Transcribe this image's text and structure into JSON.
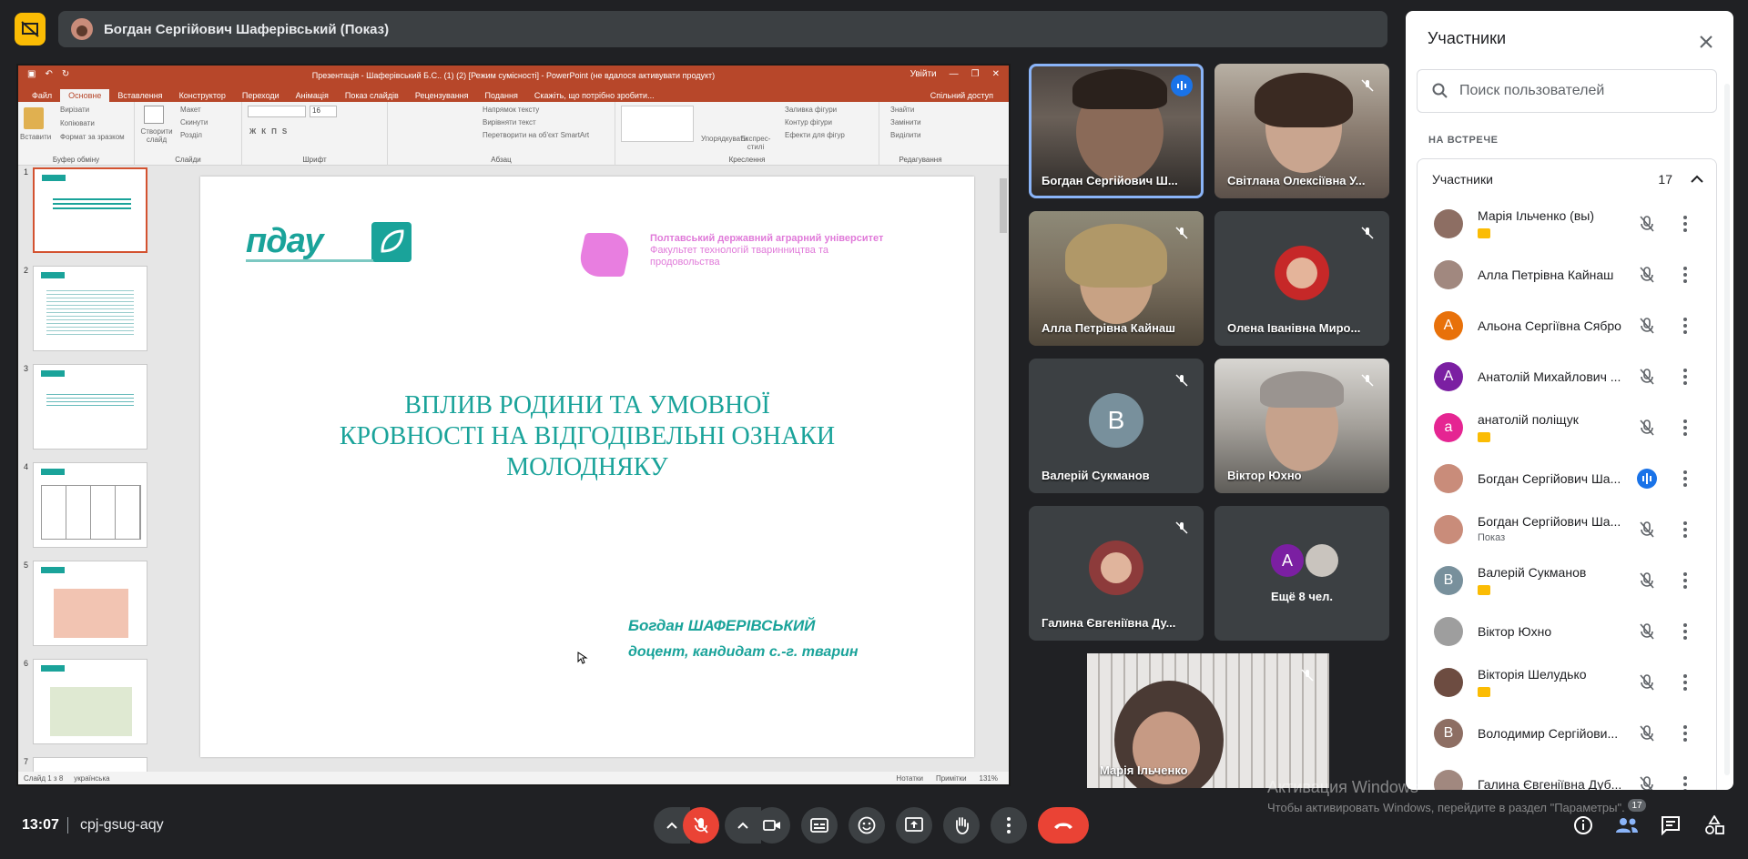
{
  "presenter_chip": {
    "label": "Богдан Сергійович Шаферівський (Показ)"
  },
  "ppt": {
    "window_title": "Презентація - Шаферівський Б.С.. (1) (2) [Режим сумісності] - PowerPoint (не вдалося активувати продукт)",
    "sign_in": "Увійти",
    "tabs": [
      "Файл",
      "Основне",
      "Вставлення",
      "Конструктор",
      "Переходи",
      "Анімація",
      "Показ слайдів",
      "Рецензування",
      "Подання",
      "Скажіть, що потрібно зробити..."
    ],
    "share": "Спільний доступ",
    "ribbon": {
      "paste": "Вставити",
      "cut": "Вирізати",
      "copy": "Копіювати",
      "format": "Формат за зразком",
      "clipboard": "Буфер обміну",
      "new_slide": "Створити слайд",
      "layout": "Макет",
      "reset": "Скинути",
      "section": "Розділ",
      "slides": "Слайди",
      "font_size": "16",
      "font": "Шрифт",
      "text_dir": "Напрямок тексту",
      "align_text": "Вирівняти текст",
      "smartart": "Перетворити на об'єкт SmartArt",
      "paragraph": "Абзац",
      "arrange": "Упорядкувати",
      "quick_styles": "Експрес-стилі",
      "shape_fill": "Заливка фігури",
      "shape_outline": "Контур фігури",
      "shape_effects": "Ефекти для фігур",
      "drawing": "Креслення",
      "find": "Знайти",
      "replace": "Замінити",
      "select": "Виділити",
      "editing": "Редагування"
    },
    "thumbnails": [
      "1",
      "2",
      "3",
      "4",
      "5",
      "6",
      "7"
    ],
    "slide": {
      "logo": "пдау",
      "logo_caption": "ПОЛТАВСЬКИЙ ДЕРЖАВНИЙ АГРАРНИЙ УНІВЕРСИТЕТ",
      "university": "Полтавський державний аграрний університет",
      "faculty_line1": "Факультет технологій тваринництва та",
      "faculty_line2": "продовольства",
      "title_line1": "ВПЛИВ РОДИНИ ТА УМОВНОЇ",
      "title_line2": "КРОВНОСТІ НА ВІДГОДІВЕЛЬНІ ОЗНАКИ",
      "title_line3": "МОЛОДНЯКУ",
      "author": "Богдан ШАФЕРІВСЬКИЙ",
      "position": "доцент, кандидат с.-г. тварин"
    },
    "status": {
      "slide_counter": "Слайд 1 з 8",
      "language": "українська",
      "notes": "Нотатки",
      "comments": "Примітки",
      "zoom": "131%"
    }
  },
  "tiles": [
    {
      "name": "Богдан Сергійович Ш...",
      "speaking": true
    },
    {
      "name": "Світлана Олексіївна У..."
    },
    {
      "name": "Алла Петрівна Кайнаш"
    },
    {
      "name": "Олена Іванівна Миро..."
    },
    {
      "name": "Валерій Сукманов",
      "initial": "В"
    },
    {
      "name": "Віктор Юхно"
    },
    {
      "name": "Галина Євгеніївна Ду..."
    },
    {
      "name": "Ещё 8 чел.",
      "initial": "А"
    },
    {
      "name": "Марія Ільченко"
    }
  ],
  "panel": {
    "title": "Участники",
    "search_placeholder": "Поиск пользователей",
    "section": "НА ВСТРЕЧЕ",
    "group_label": "Участники",
    "group_count": "17",
    "participants": [
      {
        "name": "Марія Ільченко (вы)",
        "badge": true,
        "color": "#8d6e63"
      },
      {
        "name": "Алла Петрівна Кайнаш",
        "color": "#a1887f"
      },
      {
        "name": "Альона Сергіївна Сябро",
        "initial": "А",
        "color": "#e8710a"
      },
      {
        "name": "Анатолій Михайлович ...",
        "initial": "А",
        "color": "#7b1fa2"
      },
      {
        "name": "анатолій поліщук",
        "initial": "а",
        "badge": true,
        "color": "#e52592"
      },
      {
        "name": "Богдан Сергійович Ша...",
        "speaking": true,
        "color": "#c98c7a"
      },
      {
        "name": "Богдан Сергійович Ша...",
        "sub": "Показ",
        "color": "#c98c7a"
      },
      {
        "name": "Валерій Сукманов",
        "initial": "В",
        "badge": true,
        "color": "#78909c"
      },
      {
        "name": "Віктор Юхно",
        "color": "#9e9e9e"
      },
      {
        "name": "Вікторія Шелудько",
        "badge": true,
        "color": "#6d4c41"
      },
      {
        "name": "Володимир Сергійови...",
        "initial": "В",
        "color": "#8d6e63"
      },
      {
        "name": "Галина Євгеніївна Дуб...",
        "color": "#a1887f"
      }
    ]
  },
  "bottom": {
    "time": "13:07",
    "meeting_code": "cpj-gsug-aqy",
    "people_count": "17"
  },
  "watermark": {
    "line1": "Активация Windows",
    "line2": "Чтобы активировать Windows, перейдите в раздел \"Параметры\"."
  }
}
